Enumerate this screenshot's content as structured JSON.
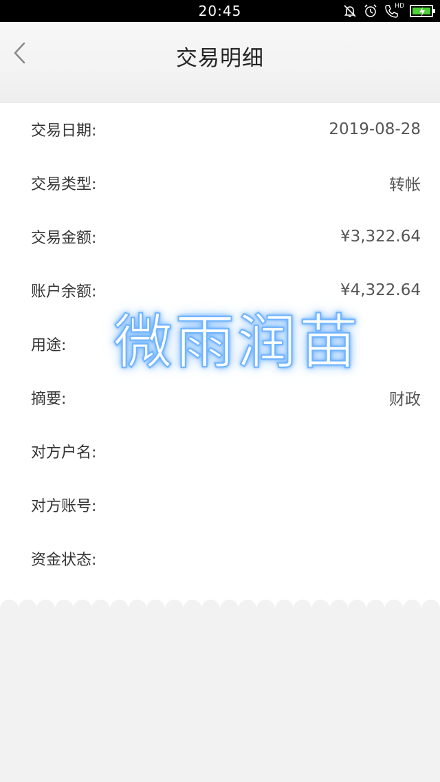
{
  "status_bar": {
    "time": "20:45",
    "icons": [
      "mute-bell-icon",
      "alarm-icon",
      "hd-call-icon",
      "battery-charging-icon"
    ],
    "hd_label": "HD",
    "battery_color": "#4cd137"
  },
  "header": {
    "back_icon": "chevron-left-icon",
    "title": "交易明细"
  },
  "details": [
    {
      "label": "交易日期:",
      "value": "2019-08-28"
    },
    {
      "label": "交易类型:",
      "value": "转帐"
    },
    {
      "label": "交易金额:",
      "value": "¥3,322.64"
    },
    {
      "label": "账户余额:",
      "value": "¥4,322.64"
    },
    {
      "label": "用途:",
      "value": ""
    },
    {
      "label": "摘要:",
      "value": "财政"
    },
    {
      "label": "对方户名:",
      "value": ""
    },
    {
      "label": "对方账号:",
      "value": ""
    },
    {
      "label": "资金状态:",
      "value": ""
    }
  ],
  "watermark": {
    "text": "微雨润苗",
    "glow_color": "#5aa8ff"
  },
  "colors": {
    "background": "#f2f2f2",
    "card": "#ffffff",
    "text": "#333333"
  }
}
